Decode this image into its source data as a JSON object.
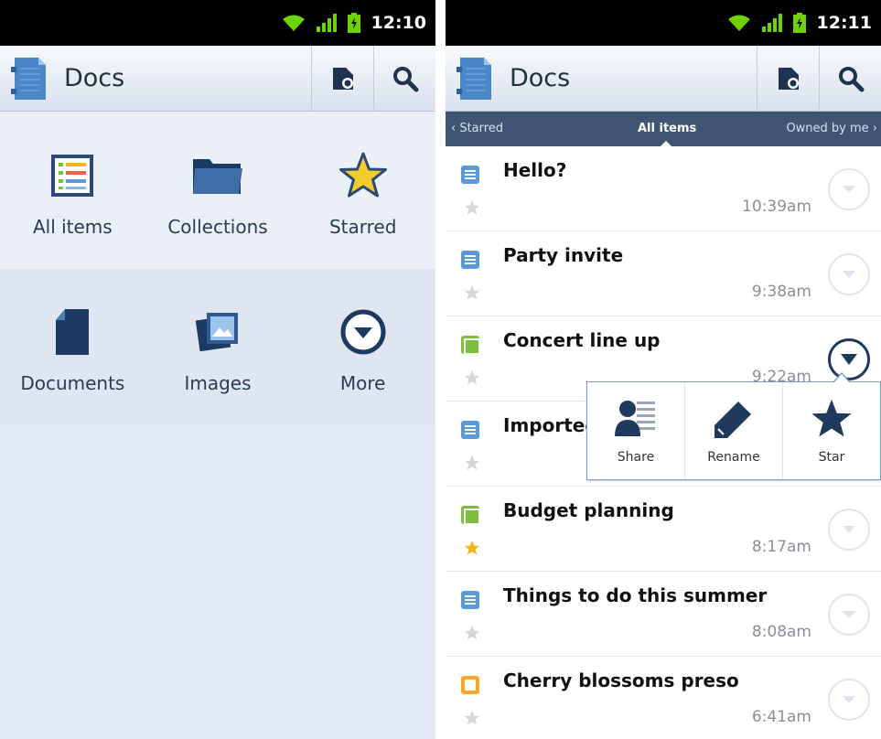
{
  "left": {
    "status": {
      "time": "12:10"
    },
    "app_title": "Docs",
    "dashboard": [
      {
        "label": "All items",
        "icon": "list-icon"
      },
      {
        "label": "Collections",
        "icon": "folder-icon"
      },
      {
        "label": "Starred",
        "icon": "star-icon"
      },
      {
        "label": "Documents",
        "icon": "document-icon"
      },
      {
        "label": "Images",
        "icon": "image-icon"
      },
      {
        "label": "More",
        "icon": "more-icon"
      }
    ]
  },
  "right": {
    "status": {
      "time": "12:11"
    },
    "app_title": "Docs",
    "tabs": {
      "prev": "‹ Starred",
      "current": "All items",
      "next": "Owned by me ›"
    },
    "items": [
      {
        "title": "Hello?",
        "time": "10:39am",
        "type": "document",
        "starred": false
      },
      {
        "title": "Party invite",
        "time": "9:38am",
        "type": "document",
        "starred": false
      },
      {
        "title": "Concert line up",
        "time": "9:22am",
        "type": "spreadsheet",
        "starred": false,
        "menu_open": true
      },
      {
        "title": "Imported",
        "time": "",
        "type": "document",
        "starred": false
      },
      {
        "title": "Budget planning",
        "time": "8:17am",
        "type": "spreadsheet",
        "starred": true
      },
      {
        "title": "Things to do this summer",
        "time": "8:08am",
        "type": "document",
        "starred": false
      },
      {
        "title": "Cherry blossoms preso",
        "time": "6:41am",
        "type": "presentation",
        "starred": false
      }
    ],
    "popup": {
      "share_label": "Share",
      "rename_label": "Rename",
      "star_label": "Star"
    }
  },
  "colors": {
    "accent": "#3e5573",
    "document": "#5b9ad6",
    "spreadsheet": "#7cbf3c",
    "presentation": "#f0a82a",
    "star_on": "#f2b51c",
    "star_off": "#d3d6da"
  }
}
